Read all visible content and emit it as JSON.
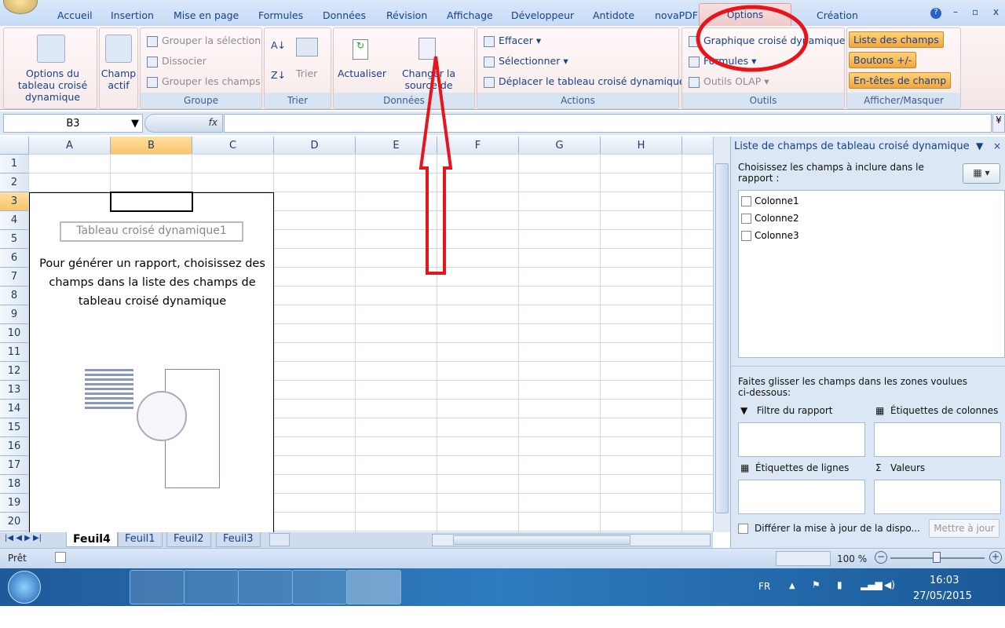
{
  "tabs": [
    "Accueil",
    "Insertion",
    "Mise en page",
    "Formules",
    "Données",
    "Révision",
    "Affichage",
    "Développeur",
    "Antidote",
    "novaPDF",
    "Options",
    "Création"
  ],
  "active_tab": "Options",
  "ribbon": {
    "pivot_options": "Options du tableau croisé dynamique",
    "active_field": "Champ actif",
    "group_selection": "Grouper la sélection",
    "ungroup": "Dissocier",
    "group_fields": "Grouper les champs",
    "group_label": "Groupe",
    "sort": "Trier",
    "sort_label": "Trier",
    "refresh": "Actualiser",
    "change_source": "Changer la source de données",
    "data_label": "Données",
    "clear": "Effacer",
    "select": "Sélectionner",
    "move": "Déplacer le tableau croisé dynamique",
    "actions_label": "Actions",
    "pivot_chart": "Graphique croisé dynamique",
    "formulas": "Formules",
    "olap": "Outils OLAP",
    "tools_label": "Outils",
    "field_list": "Liste des champs",
    "buttons": "Boutons +/-",
    "headers": "En-têtes de champ",
    "show_label": "Afficher/Masquer"
  },
  "formula_bar": {
    "name_box": "B3",
    "fx": "fx",
    "value": ""
  },
  "columns": [
    "A",
    "B",
    "C",
    "D",
    "E",
    "F",
    "G",
    "H"
  ],
  "rows": [
    "1",
    "2",
    "3",
    "4",
    "5",
    "6",
    "7",
    "8",
    "9",
    "10",
    "11",
    "12",
    "13",
    "14",
    "15",
    "16",
    "17",
    "18",
    "19",
    "20"
  ],
  "selected_cell": "B3",
  "pivot": {
    "title": "Tableau croisé dynamique1",
    "message": "Pour générer un rapport, choisissez des champs dans la liste des champs de tableau croisé dynamique"
  },
  "panel": {
    "title": "Liste de champs de tableau croisé dynamique",
    "choose": "Choisissez les champs à inclure dans le rapport :",
    "fields": [
      {
        "label": "Colonne1",
        "checked": false
      },
      {
        "label": "Colonne2",
        "checked": false
      },
      {
        "label": "Colonne3",
        "checked": false
      }
    ],
    "drag": "Faites glisser les champs dans les zones voulues ci-dessous:",
    "report_filter": "Filtre du rapport",
    "column_labels": "Étiquettes de colonnes",
    "row_labels": "Étiquettes de lignes",
    "values": "Valeurs",
    "defer": "Différer la mise à jour de la dispo...",
    "update": "Mettre à jour"
  },
  "sheets": [
    "Feuil4",
    "Feuil1",
    "Feuil2",
    "Feuil3"
  ],
  "active_sheet": "Feuil4",
  "status": {
    "ready": "Prêt",
    "zoom": "100 %"
  },
  "taskbar": {
    "lang": "FR",
    "time": "16:03",
    "date": "27/05/2015"
  },
  "annotation_color": "#e8141c"
}
